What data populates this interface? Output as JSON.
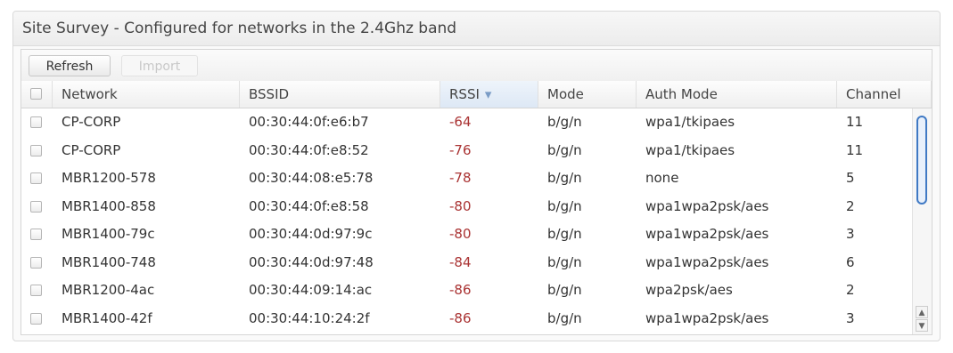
{
  "panel": {
    "title": "Site Survey - Configured for networks in the 2.4Ghz band"
  },
  "toolbar": {
    "refresh_label": "Refresh",
    "import_label": "Import"
  },
  "table": {
    "columns": {
      "network": "Network",
      "bssid": "BSSID",
      "rssi": "RSSI",
      "mode": "Mode",
      "auth_mode": "Auth Mode",
      "channel": "Channel"
    },
    "sort_indicator": "▾",
    "rows": [
      {
        "network": "CP-CORP",
        "bssid": "00:30:44:0f:e6:b7",
        "rssi": "-64",
        "mode": "b/g/n",
        "auth_mode": "wpa1/tkipaes",
        "channel": "11"
      },
      {
        "network": "CP-CORP",
        "bssid": "00:30:44:0f:e8:52",
        "rssi": "-76",
        "mode": "b/g/n",
        "auth_mode": "wpa1/tkipaes",
        "channel": "11"
      },
      {
        "network": "MBR1200-578",
        "bssid": "00:30:44:08:e5:78",
        "rssi": "-78",
        "mode": "b/g/n",
        "auth_mode": "none",
        "channel": "5"
      },
      {
        "network": "MBR1400-858",
        "bssid": "00:30:44:0f:e8:58",
        "rssi": "-80",
        "mode": "b/g/n",
        "auth_mode": "wpa1wpa2psk/aes",
        "channel": "2"
      },
      {
        "network": "MBR1400-79c",
        "bssid": "00:30:44:0d:97:9c",
        "rssi": "-80",
        "mode": "b/g/n",
        "auth_mode": "wpa1wpa2psk/aes",
        "channel": "3"
      },
      {
        "network": "MBR1400-748",
        "bssid": "00:30:44:0d:97:48",
        "rssi": "-84",
        "mode": "b/g/n",
        "auth_mode": "wpa1wpa2psk/aes",
        "channel": "6"
      },
      {
        "network": "MBR1200-4ac",
        "bssid": "00:30:44:09:14:ac",
        "rssi": "-86",
        "mode": "b/g/n",
        "auth_mode": "wpa2psk/aes",
        "channel": "2"
      },
      {
        "network": "MBR1400-42f",
        "bssid": "00:30:44:10:24:2f",
        "rssi": "-86",
        "mode": "b/g/n",
        "auth_mode": "wpa1wpa2psk/aes",
        "channel": "3"
      }
    ]
  },
  "colors": {
    "rssi_text": "#aa3333",
    "accent": "#3f79c4"
  },
  "icons": {
    "scroll_up": "▲",
    "scroll_down": "▼"
  }
}
